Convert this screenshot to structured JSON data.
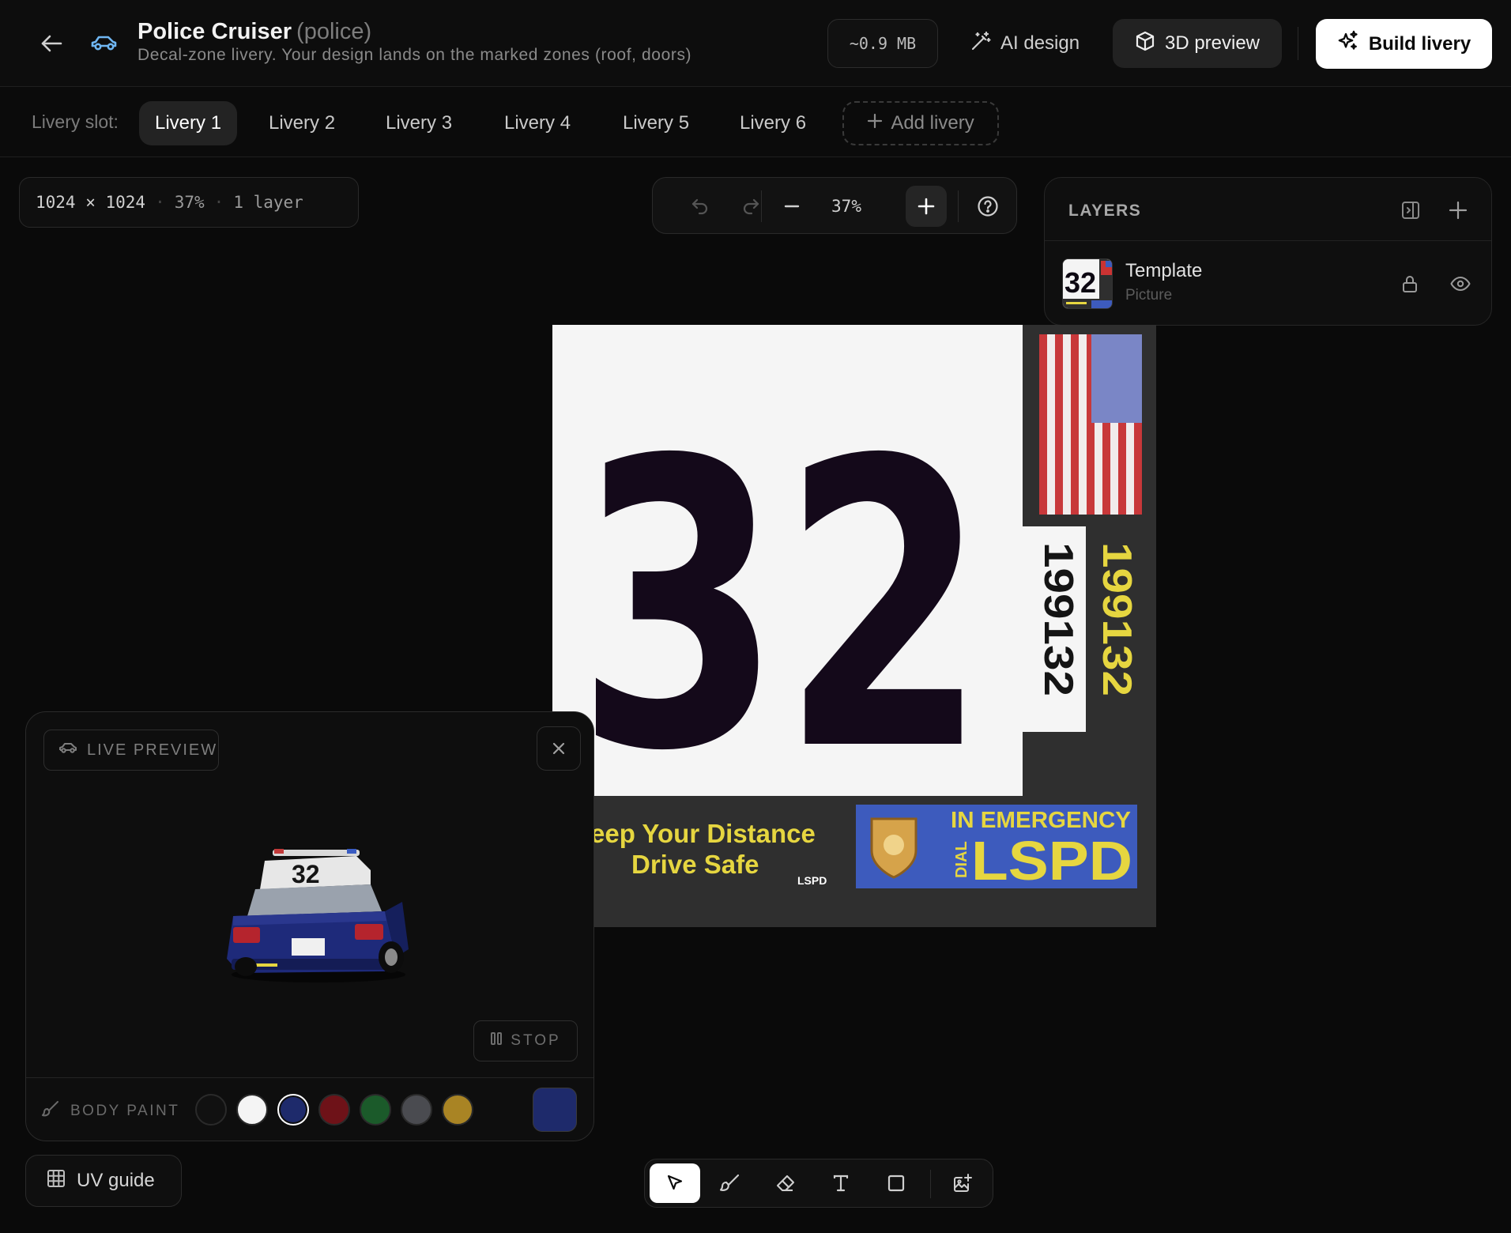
{
  "header": {
    "title": "Police Cruiser",
    "slug": "(police)",
    "subtitle": "Decal-zone livery. Your design lands on the marked zones (roof, doors)",
    "size": "~0.9 MB",
    "ai_design_label": "AI design",
    "preview_label": "3D preview",
    "build_label": "Build livery"
  },
  "slots": {
    "label": "Livery slot:",
    "tabs": [
      "Livery 1",
      "Livery 2",
      "Livery 3",
      "Livery 4",
      "Livery 5",
      "Livery 6"
    ],
    "active_index": 0,
    "add_label": "Add livery"
  },
  "canvas_info": {
    "dimensions": "1024 × 1024",
    "zoom": "37%",
    "layers": "1 layer"
  },
  "zoombar": {
    "zoom": "37%"
  },
  "layers_panel": {
    "title": "LAYERS",
    "items": [
      {
        "name": "Template",
        "type": "Picture"
      }
    ]
  },
  "texture": {
    "big_number": "32",
    "thumb_number": "32",
    "plate_black": "199132",
    "plate_yellow": "199132",
    "slogan_line1": "eep Your Distance",
    "slogan_line2": "Drive Safe",
    "slogan_tag": "LSPD",
    "emergency_top": "IN EMERGENCY",
    "emergency_dial": "DIAL",
    "emergency_big": "LSPD",
    "roof_number": "32"
  },
  "live_preview": {
    "tag": "LIVE PREVIEW",
    "stop_label": "STOP",
    "body_paint_label": "BODY PAINT",
    "swatches": [
      "#111111",
      "#f4f4f4",
      "#1e2a6b",
      "#6e1218",
      "#1b5a2a",
      "#4a4b50",
      "#a98424"
    ],
    "selected_swatch": 2,
    "current_color": "#1e2a6b"
  },
  "uv_guide_label": "UV guide",
  "colors": {
    "background": "#0a0a0a",
    "accent_icon": "#6fb6f2",
    "decal_yellow": "#e6d640",
    "decal_blue": "#3d5bbd"
  }
}
